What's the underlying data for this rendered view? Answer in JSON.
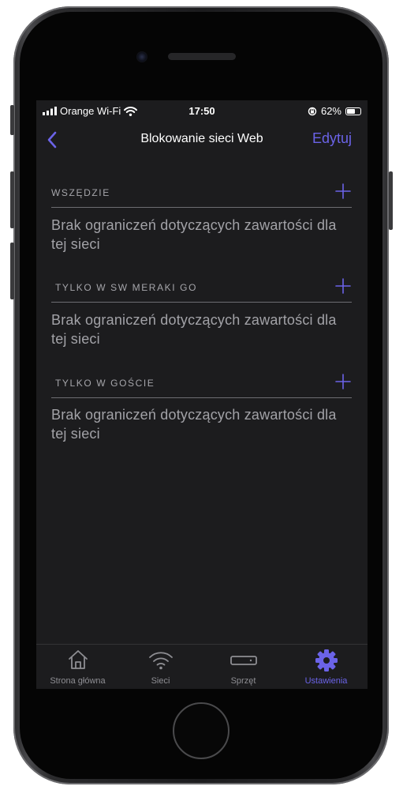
{
  "status_bar": {
    "carrier": "Orange Wi-Fi",
    "time": "17:50",
    "battery": "62%",
    "battery_level": 0.62
  },
  "nav": {
    "title": "Blokowanie sieci Web",
    "edit_label": "Edytuj"
  },
  "sections": [
    {
      "header": "WSZĘDZIE",
      "body": " Brak ograniczeń dotyczących zawartości dla tej sieci"
    },
    {
      "header": "TYLKO W SW MERAKI GO",
      "body": " Brak ograniczeń dotyczących zawartości dla tej sieci"
    },
    {
      "header": "TYLKO W GOŚCIE",
      "body": " Brak ograniczeń dotyczących zawartości dla tej sieci"
    }
  ],
  "tabs": [
    {
      "label": "Strona główna",
      "icon": "home-icon"
    },
    {
      "label": "Sieci",
      "icon": "wifi-icon"
    },
    {
      "label": "Sprzęt",
      "icon": "device-icon"
    },
    {
      "label": "Ustawienia",
      "icon": "gear-icon",
      "active": true
    }
  ],
  "colors": {
    "accent": "#6b63e8",
    "background": "#1c1c1e",
    "inactive_tab": "#8e8e93"
  }
}
